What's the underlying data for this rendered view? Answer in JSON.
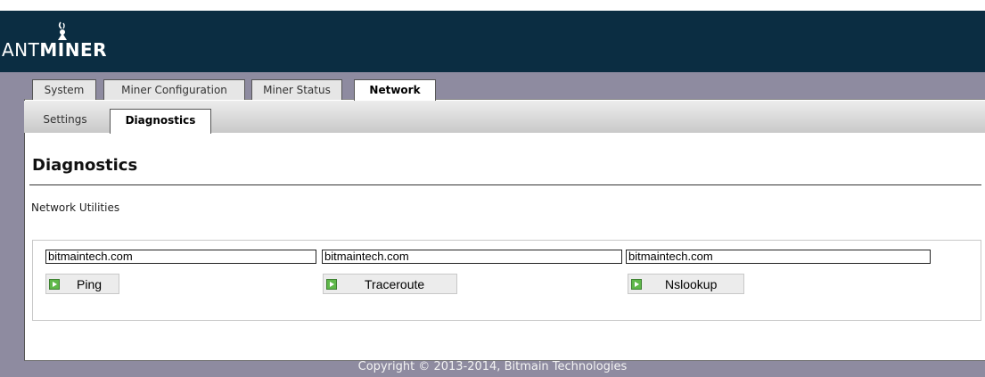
{
  "header": {
    "logo_ant": "ANT",
    "logo_miner": "MINER",
    "logo_icon": "ant-logo-icon"
  },
  "tabs": [
    {
      "label": "System"
    },
    {
      "label": "Miner Configuration"
    },
    {
      "label": "Miner Status"
    },
    {
      "label": "Network",
      "active": true
    }
  ],
  "subtabs": [
    {
      "label": "Settings"
    },
    {
      "label": "Diagnostics",
      "active": true
    }
  ],
  "page": {
    "title": "Diagnostics",
    "section": "Network Utilities"
  },
  "utilities": [
    {
      "host": "bitmaintech.com",
      "button": "Ping",
      "icon": "play-icon"
    },
    {
      "host": "bitmaintech.com",
      "button": "Traceroute",
      "icon": "play-icon"
    },
    {
      "host": "bitmaintech.com",
      "button": "Nslookup",
      "icon": "play-icon"
    }
  ],
  "footer": {
    "copyright": "Copyright © 2013-2014, Bitmain Technologies"
  },
  "colors": {
    "header_bg": "#0b2d42",
    "band_bg": "#8e8ba0",
    "button_icon": "#5fb84a"
  }
}
